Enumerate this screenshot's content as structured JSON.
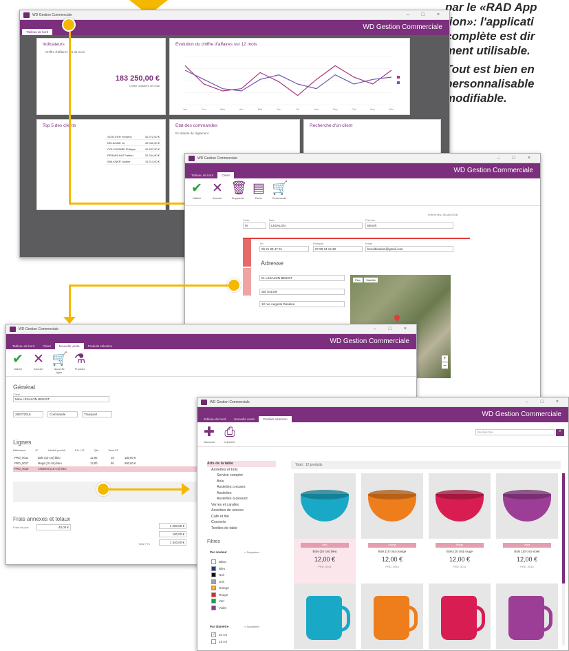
{
  "caption": {
    "line1": "par le «RAD App",
    "line2": "tion»: l'applicati",
    "line3": "complète est dir",
    "line4": "ment utilisable.",
    "line5": "Tout est bien en",
    "line6": "personnalisable",
    "line7": "modifiable."
  },
  "app": {
    "window_title": "WD Gestion Commerciale",
    "app_title": "WD Gestion Commerciale",
    "minimize": "–",
    "maximize": "□",
    "close": "×"
  },
  "dashboard": {
    "tab": "Tableau de bord",
    "indicators_title": "Indicateurs",
    "revenue_caption": "Chiffre d'affaires net du mois",
    "revenue_value": "183 250,00 €",
    "revenue_sub": "Chiffre d'affaires net total",
    "chart_title": "Evolution du chiffre d'affaires sur 12 mois",
    "top5_title": "Top 5 des clients",
    "top5": [
      {
        "name": "SCHLITER Frédéric",
        "value": "40 372,00 €"
      },
      {
        "name": "DELAHAIE Jo",
        "value": "40 060,00 €"
      },
      {
        "name": "COLCHOMBE Philippe",
        "value": "40 657,00 €"
      },
      {
        "name": "PERARCHAT Fabien",
        "value": "32 344,00 €"
      },
      {
        "name": "WALKNER Justine",
        "value": "31 513,00 €"
      }
    ],
    "orders_title": "Etat des commandes",
    "orders_item": "En attente de règlement",
    "search_title": "Recherche d'un client"
  },
  "chart_data": {
    "type": "line",
    "title": "Evolution du chiffre d'affaires sur 12 mois",
    "categories": [
      "Jan",
      "Fév",
      "Mar",
      "Avr",
      "Mai",
      "Jun",
      "Jul",
      "Aoû",
      "Sep",
      "Oct",
      "Nov",
      "Déc"
    ],
    "series": [
      {
        "name": "",
        "color": "#a8367c",
        "values": [
          150,
          110,
          95,
          100,
          135,
          115,
          85,
          120,
          150,
          125,
          110,
          140
        ]
      },
      {
        "name": "",
        "color": "#6a5ab0",
        "values": [
          140,
          120,
          100,
          95,
          120,
          130,
          110,
          100,
          130,
          110,
          120,
          125
        ]
      }
    ]
  },
  "client": {
    "tabs": [
      "Tableau de bord",
      "Client"
    ],
    "ribbon": [
      "Valider",
      "Annuler",
      "Supprimer",
      "Devis",
      "Commande"
    ],
    "groups": [
      "Général",
      "Liste"
    ],
    "created": "Créé le jeu. 28 juin 2018",
    "code_label": "Code",
    "name_label": "Nom",
    "firstname_label": "Prénom",
    "code": "M.",
    "lastname": "LESALON",
    "firstname": "Benoît",
    "phone_label": "Tél",
    "mobile_label": "Portable",
    "email_label": "Email",
    "phone": "06 21 98 47 01",
    "mobile": "07 89 24 12 38",
    "email": "benoitlesalon@gmail.com",
    "address_title": "Adresse",
    "address_name": "M. LESALON BENOIT",
    "address_company": "Sté SALON",
    "address_street": "12 rue Auguste Dandine",
    "map_btn1": "Plan",
    "map_btn2": "Satellite"
  },
  "order": {
    "tabs": [
      "Tableau de bord",
      "Client",
      "Nouvelle vente",
      "Produits sélection"
    ],
    "ribbon": [
      "Valider",
      "Annuler",
      "Nouvelle ligne",
      "Produits"
    ],
    "section_general": "Général",
    "client_label": "Client",
    "client_value": "Mme LESALON BENOIT",
    "date_value": "28/07/2018",
    "status_value": "Commande",
    "payment_value": "Transport",
    "lines_title": "Lignes",
    "columns": [
      "Référence",
      "N°",
      "Libellé produit",
      "P.U. HT",
      "Qté",
      "Total HT"
    ],
    "lines": [
      {
        "ref": "PRD_0011",
        "label": "Bols (10 cm) bleu",
        "pu": "12,00",
        "qty": "15",
        "total": "180,00 €"
      },
      {
        "ref": "PRD_0017",
        "label": "Mugs (10 cm) bleu",
        "pu": "12,00",
        "qty": "50",
        "total": "600,00 €"
      },
      {
        "ref": "PRD_0016",
        "label": "Assiettes (15 cm) bleu",
        "pu": "",
        "qty": "",
        "total": ""
      }
    ],
    "fees_title": "Frais annexes et totaux",
    "fees_label": "Frais de port",
    "fees_value": "40,00 €",
    "total1": "1 200,00 €",
    "total2": "100,00 €",
    "total_ttc_label": "Total TTC",
    "total_ttc": "1 340,00 €"
  },
  "products": {
    "tabs": [
      "Tableau de bord",
      "Nouvelle vente",
      "Produits sélection"
    ],
    "ribbon": [
      "Nouveau",
      "Imprimer"
    ],
    "search_placeholder": "Rechercher",
    "categories": [
      "Arts de la table",
      "Assiettes et bols",
      "Service complet",
      "Bols",
      "Assiettes creuses",
      "Assiettes",
      "Assiettes à dessert",
      "Verres et carafes",
      "Assiettes de service",
      "Café et thé",
      "Couverts",
      "Textiles de table"
    ],
    "filters_title": "Filtres",
    "by_color": "Par couleur",
    "clear": "× Supprimer",
    "colors": [
      {
        "name": "Blanc",
        "hex": "#ffffff",
        "checked": false
      },
      {
        "name": "Bleu",
        "hex": "#1e3a8a",
        "checked": false
      },
      {
        "name": "Noir",
        "hex": "#111111",
        "checked": false
      },
      {
        "name": "Gris",
        "hex": "#9ca3af",
        "checked": false
      },
      {
        "name": "Orange",
        "hex": "#f59e0b",
        "checked": true
      },
      {
        "name": "Rouge",
        "hex": "#dc2626",
        "checked": false
      },
      {
        "name": "Vert",
        "hex": "#16a34a",
        "checked": false
      },
      {
        "name": "Violet",
        "hex": "#8b3a8b",
        "checked": false
      }
    ],
    "by_diameter": "Par diamètre",
    "diameters": [
      "10 cm",
      "15 cm"
    ],
    "total": "Total : 12 produits",
    "items": [
      {
        "color": "#19a9c6",
        "badge": "Bleu",
        "name": "Bols (10 cm) bleu",
        "price": "12,00 €",
        "ref": "PRD_0011"
      },
      {
        "color": "#ee7d1c",
        "badge": "Orange",
        "name": "Bols (10 cm) orange",
        "price": "12,00 €",
        "ref": "PRD_0010"
      },
      {
        "color": "#d81d52",
        "badge": "Rouge",
        "name": "Bols (10 cm) rouge",
        "price": "12,00 €",
        "ref": "PRD_0011"
      },
      {
        "color": "#9c3e96",
        "badge": "Violet",
        "name": "Bols (10 cm) violet",
        "price": "12,00 €",
        "ref": "PRD_0014"
      }
    ],
    "mugs": [
      "#19a9c6",
      "#ee7d1c",
      "#d81d52",
      "#9c3e96"
    ]
  }
}
